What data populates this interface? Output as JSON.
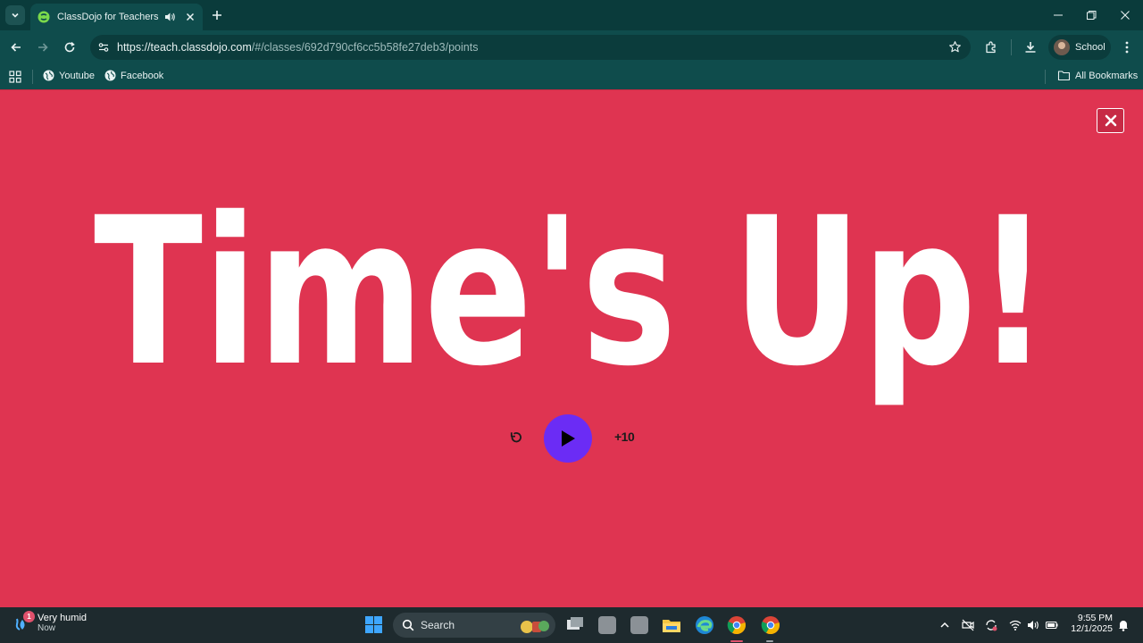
{
  "browser": {
    "tab_title": "ClassDojo for Teachers",
    "url_domain": "https://teach.classdojo.com",
    "url_path": "/#/classes/692d790cf6cc5b58fe27deb3/points",
    "profile_label": "School",
    "bookmarks": [
      {
        "label": "Youtube"
      },
      {
        "label": "Facebook"
      }
    ],
    "all_bookmarks_label": "All Bookmarks"
  },
  "timer": {
    "headline": "Time's Up!",
    "add_time_label": "+10",
    "background_color": "#df3451",
    "play_color": "#6b2cf5"
  },
  "taskbar": {
    "weather_main": "Very humid",
    "weather_sub": "Now",
    "weather_badge": "1",
    "search_label": "Search",
    "time": "9:55 PM",
    "date": "12/1/2025"
  }
}
